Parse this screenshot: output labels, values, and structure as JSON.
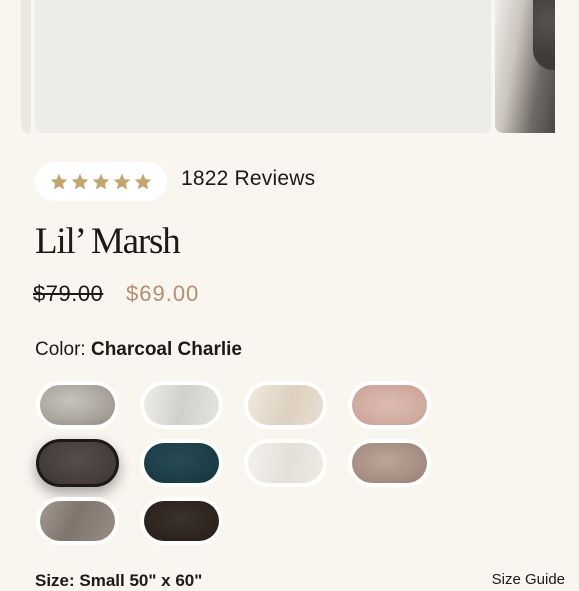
{
  "gallery": {
    "images": [
      "main-image",
      "next-image"
    ]
  },
  "reviews": {
    "rating": 5,
    "max": 5,
    "count_text": "1822 Reviews",
    "star_color": "#c2a571"
  },
  "product": {
    "title": "Lil’ Marsh",
    "price_original": "$79.00",
    "price_sale": "$69.00",
    "sale_color": "#b38e72"
  },
  "color": {
    "label": "Color:",
    "selected": "Charcoal Charlie",
    "swatches": [
      {
        "name": "light-gray",
        "color": "#a9a49b"
      },
      {
        "name": "silver",
        "color": "#dcdad6"
      },
      {
        "name": "cream",
        "color": "#e7dccd"
      },
      {
        "name": "blush",
        "color": "#d4b0a6"
      },
      {
        "name": "charcoal-charlie",
        "color": "#4a423e",
        "selected": true
      },
      {
        "name": "teal",
        "color": "#1d3e48"
      },
      {
        "name": "ivory",
        "color": "#ebe8e1"
      },
      {
        "name": "mocha",
        "color": "#ad958a"
      },
      {
        "name": "taupe",
        "color": "#8b8179"
      },
      {
        "name": "espresso",
        "color": "#2f2621"
      }
    ]
  },
  "size": {
    "label": "Size: Small 50\" x 60\"",
    "guide": "Size Guide"
  }
}
